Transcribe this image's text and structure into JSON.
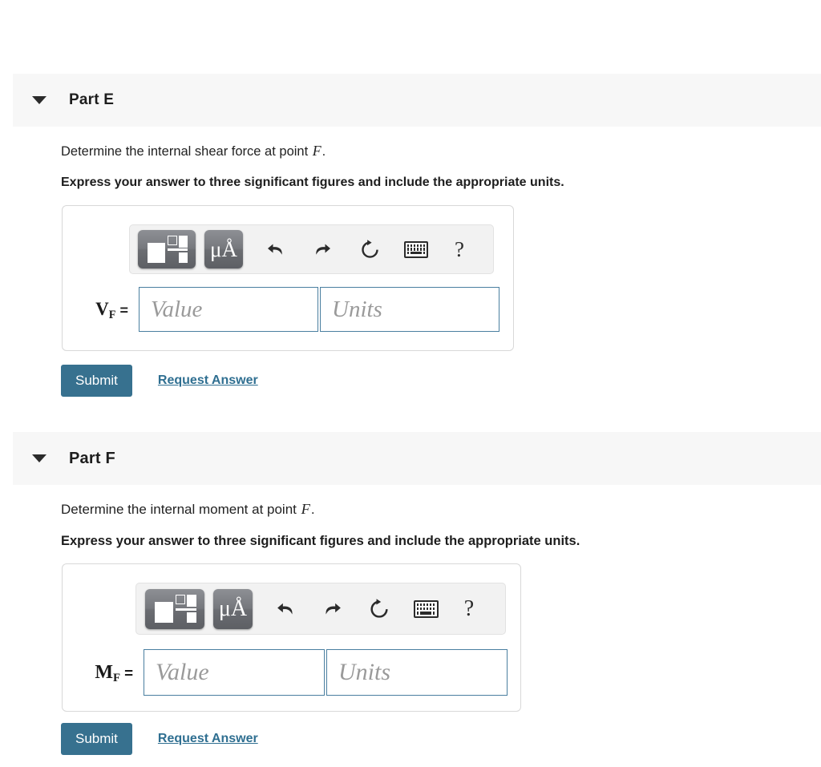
{
  "colors": {
    "accent": "#37718f",
    "link": "#2f6f91",
    "header_bg": "#f7f7f7",
    "field_border": "#4a7fa0",
    "page_bg": "#ffffff"
  },
  "parts": [
    {
      "id": "part-e",
      "title": "Part E",
      "collapse_icon": "triangle-down-icon",
      "prompt_before": "Determine the internal shear force at point ",
      "prompt_var": "F",
      "prompt_after": ".",
      "instruction": "Express your answer to three significant figures and include the appropriate units.",
      "toolbar": {
        "template_button_label": "math-template",
        "units_button_label": "μÅ",
        "undo_label": "undo",
        "redo_label": "redo",
        "reset_label": "reset",
        "keyboard_label": "keyboard-shortcuts",
        "help_label": "?"
      },
      "answer": {
        "variable": "V",
        "subscript": "F",
        "equals": "=",
        "value_placeholder": "Value",
        "value_text": "",
        "units_placeholder": "Units",
        "units_text": ""
      },
      "submit_label": "Submit",
      "request_answer_label": "Request Answer"
    },
    {
      "id": "part-f",
      "title": "Part F",
      "collapse_icon": "triangle-down-icon",
      "prompt_before": "Determine the internal moment at point ",
      "prompt_var": "F",
      "prompt_after": ".",
      "instruction": "Express your answer to three significant figures and include the appropriate units.",
      "toolbar": {
        "template_button_label": "math-template",
        "units_button_label": "μÅ",
        "undo_label": "undo",
        "redo_label": "redo",
        "reset_label": "reset",
        "keyboard_label": "keyboard-shortcuts",
        "help_label": "?"
      },
      "answer": {
        "variable": "M",
        "subscript": "F",
        "equals": "=",
        "value_placeholder": "Value",
        "value_text": "",
        "units_placeholder": "Units",
        "units_text": ""
      },
      "submit_label": "Submit",
      "request_answer_label": "Request Answer"
    }
  ]
}
